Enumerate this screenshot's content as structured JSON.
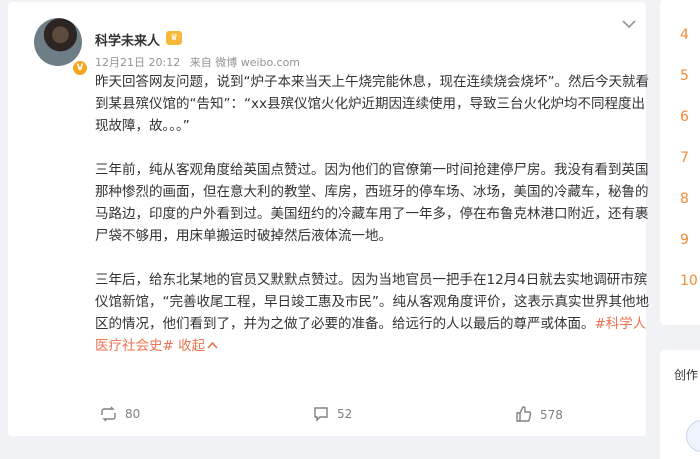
{
  "post": {
    "username": "科学未来人",
    "meta_date": "12月21日 20:12",
    "meta_source": "来自 微博 weibo.com",
    "paragraphs": [
      "昨天回答网友问题，说到“炉子本来当天上午烧完能休息，现在连续烧会烧坏”。然后今天就看到某县殡仪馆的“告知”：“xx县殡仪馆火化炉近期因连续使用，导致三台火化炉均不同程度出现故障，故。。。”",
      "三年前，纯从客观角度给英国点赞过。因为他们的官僚第一时间抢建停尸房。我没有看到英国那种惨烈的画面，但在意大利的教堂、库房，西班牙的停车场、冰场，美国的冷藏车，秘鲁的马路边，印度的户外看到过。美国纽约的冷藏车用了一年多，停在布鲁克林港口附近，还有裹尸袋不够用，用床单搬运时破掉然后液体流一地。"
    ],
    "last_paragraph": "三年后，给东北某地的官员又默默点赞过。因为当地官员一把手在12月4日就去实地调研市殡仪馆新馆，“完善收尾工程，早日竣工惠及市民”。纯从客观角度评价，这表示真实世界其他地区的情况，他们看到了，并为之做了必要的准备。给远行的人以最后的尊严或体面。",
    "hashtag": "#科学人医疗社会史#",
    "collapse": "收起",
    "reposts": "80",
    "comments": "52",
    "likes": "578"
  },
  "rail": {
    "ranks": [
      "4",
      "5",
      "6",
      "7",
      "8",
      "9",
      "10"
    ],
    "label": "创作"
  },
  "colors": {
    "accent": "#eb7350",
    "rank": "#f28b34"
  },
  "icons": [
    "repost-icon",
    "comment-icon",
    "like-icon",
    "chevron-down-icon",
    "verified-badge-icon",
    "crown-icon"
  ]
}
